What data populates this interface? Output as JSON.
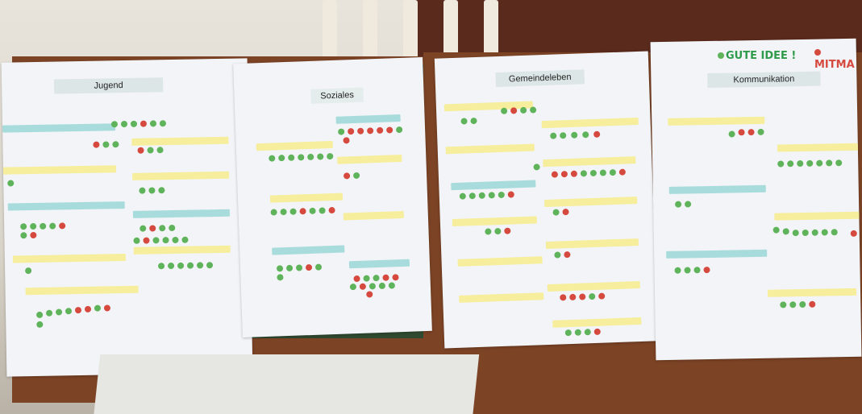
{
  "photo": {
    "sheets": [
      {
        "title": "Jugend"
      },
      {
        "title": "Soziales"
      },
      {
        "title": "Gemeindeleben"
      },
      {
        "title": "Kommunikation"
      }
    ],
    "handwritten": [
      {
        "text": "GUTE IDEE !",
        "color": "#2f9a4a"
      },
      {
        "text": "MITMA",
        "color": "#d6493f"
      }
    ],
    "colors": {
      "dot_green": "#5fb35a",
      "dot_red": "#d6493f",
      "note_yellow": "#f6ee9c",
      "note_blue": "#a8dcdc"
    }
  }
}
